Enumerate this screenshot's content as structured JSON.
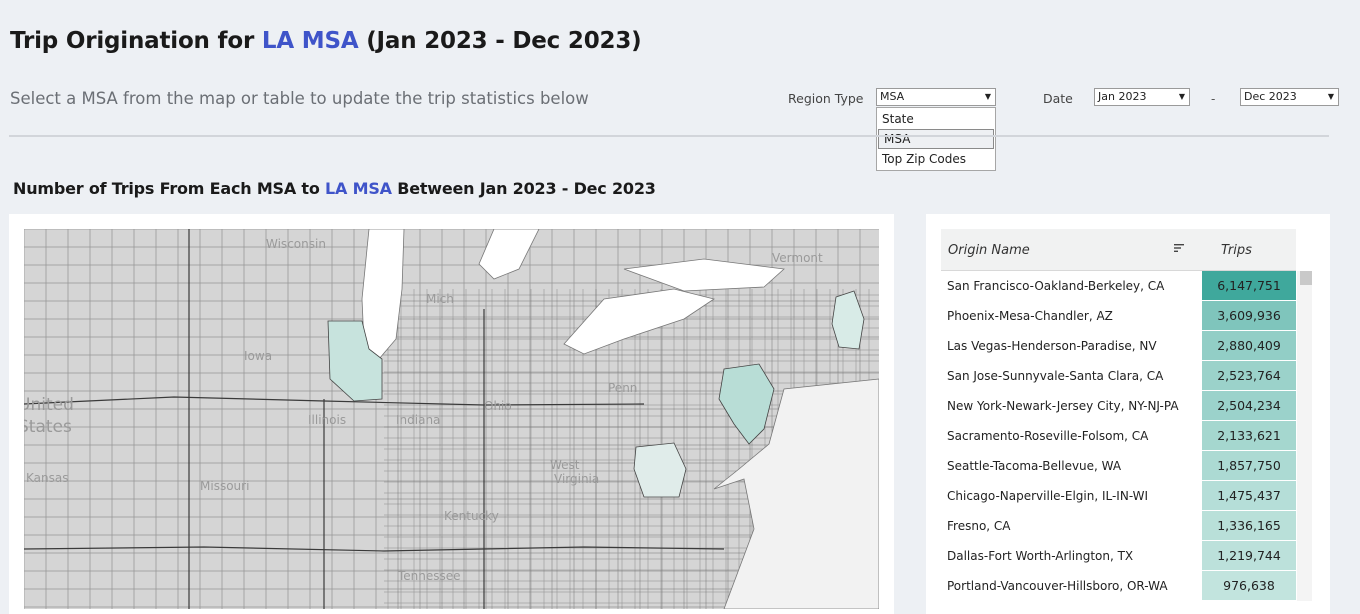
{
  "header": {
    "title_pre": "Trip Origination for ",
    "title_hl": "LA MSA",
    "title_post": " (Jan 2023 - Dec 2023)",
    "subtitle": "Select a MSA from the map or table to update the trip statistics below"
  },
  "controls": {
    "region_type_label": "Region Type",
    "region_type_value": "MSA",
    "region_type_options": [
      "State",
      "MSA",
      "Top Zip Codes"
    ],
    "date_label": "Date",
    "date_start": "Jan 2023",
    "date_separator": "-",
    "date_end": "Dec 2023"
  },
  "section": {
    "pre": "Number of Trips From Each MSA to ",
    "hl": "LA MSA",
    "post": " Between Jan 2023 - Dec 2023"
  },
  "map": {
    "labels": [
      "Wisconsin",
      "Vermont",
      "Mich",
      "Penn",
      "United",
      "States",
      "Iowa",
      "Illinois",
      "Indiana",
      "Ohio",
      "West",
      "Virginia",
      "Kansas",
      "Missouri",
      "Kentucky",
      "Tennessee"
    ]
  },
  "table": {
    "col_origin": "Origin Name",
    "col_trips": "Trips",
    "rows": [
      {
        "name": "San Francisco-Oakland-Berkeley, CA",
        "trips": "6,147,751",
        "value": 6147751
      },
      {
        "name": "Phoenix-Mesa-Chandler, AZ",
        "trips": "3,609,936",
        "value": 3609936
      },
      {
        "name": "Las Vegas-Henderson-Paradise, NV",
        "trips": "2,880,409",
        "value": 2880409
      },
      {
        "name": "San Jose-Sunnyvale-Santa Clara, CA",
        "trips": "2,523,764",
        "value": 2523764
      },
      {
        "name": "New York-Newark-Jersey City, NY-NJ-PA",
        "trips": "2,504,234",
        "value": 2504234
      },
      {
        "name": "Sacramento-Roseville-Folsom, CA",
        "trips": "2,133,621",
        "value": 2133621
      },
      {
        "name": "Seattle-Tacoma-Bellevue, WA",
        "trips": "1,857,750",
        "value": 1857750
      },
      {
        "name": "Chicago-Naperville-Elgin, IL-IN-WI",
        "trips": "1,475,437",
        "value": 1475437
      },
      {
        "name": "Fresno, CA",
        "trips": "1,336,165",
        "value": 1336165
      },
      {
        "name": "Dallas-Fort Worth-Arlington, TX",
        "trips": "1,219,744",
        "value": 1219744
      },
      {
        "name": "Portland-Vancouver-Hillsboro, OR-WA",
        "trips": "976,638",
        "value": 976638
      }
    ]
  },
  "colors": {
    "accent": "#3f54c9",
    "teal_high": "#3fa89c",
    "teal_low": "#c2e4de",
    "background": "#edf0f4"
  }
}
